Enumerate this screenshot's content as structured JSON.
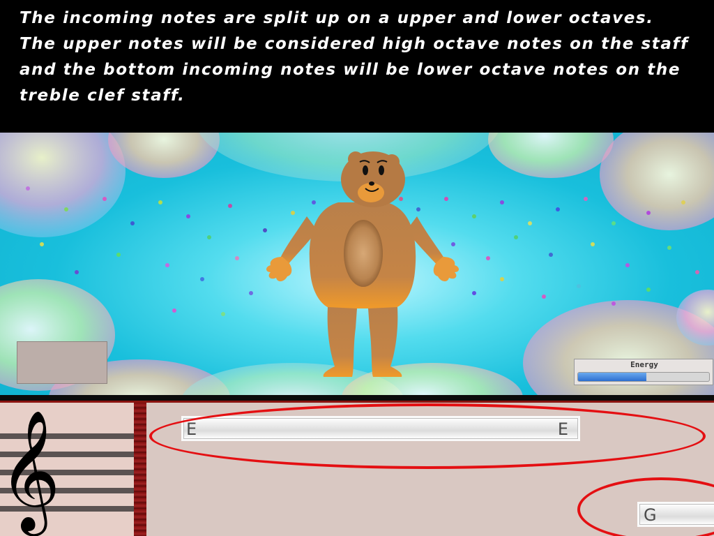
{
  "instructions": {
    "text": "The incoming notes are split up on a upper and lower octaves.\nThe upper notes will be considered high octave notes on the staff\nand the bottom incoming notes will be lower octave notes on the\ntreble clef staff."
  },
  "hud": {
    "energy_label": "Energy",
    "energy_fraction": 0.52
  },
  "staff": {
    "clef_glyph": "𝄞"
  },
  "notes": {
    "upper_lane": {
      "start_label": "E",
      "end_label": "E"
    },
    "lower_lane": {
      "label": "G"
    }
  },
  "colors": {
    "highlight_ring": "#e40f12",
    "energy_fill": "#2d6fd0"
  }
}
